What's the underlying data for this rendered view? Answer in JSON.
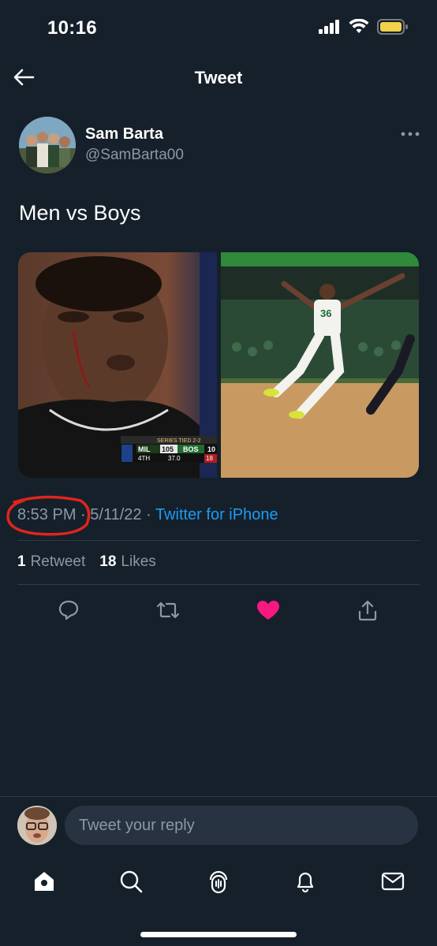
{
  "status_bar": {
    "time": "10:16"
  },
  "nav": {
    "title": "Tweet"
  },
  "author": {
    "name": "Sam Barta",
    "handle": "@SamBarta00"
  },
  "tweet": {
    "text": "Men vs Boys",
    "time": "8:53 PM",
    "separator": " · ",
    "date": "5/11/22",
    "source": "Twitter for iPhone"
  },
  "scoreboard": {
    "series_text": "SERIES TIED 2-2",
    "team1": "MIL",
    "score1": "105",
    "team2": "BOS",
    "score2": "10",
    "quarter": "4TH",
    "clock": "37.0",
    "shot_clock": "18"
  },
  "jersey_number": "36",
  "stats": {
    "retweets_count": "1",
    "retweets_label": "Retweet",
    "likes_count": "18",
    "likes_label": "Likes"
  },
  "reply": {
    "placeholder": "Tweet your reply"
  },
  "colors": {
    "background": "#15202b",
    "accent": "#1d9bf0",
    "like": "#f91880",
    "annotation": "#e0251b"
  },
  "icons": {
    "actions": [
      "reply-icon",
      "retweet-icon",
      "like-icon-filled",
      "share-icon"
    ],
    "tabs": [
      "home-icon",
      "search-icon",
      "spaces-icon",
      "notifications-icon",
      "messages-icon"
    ]
  }
}
